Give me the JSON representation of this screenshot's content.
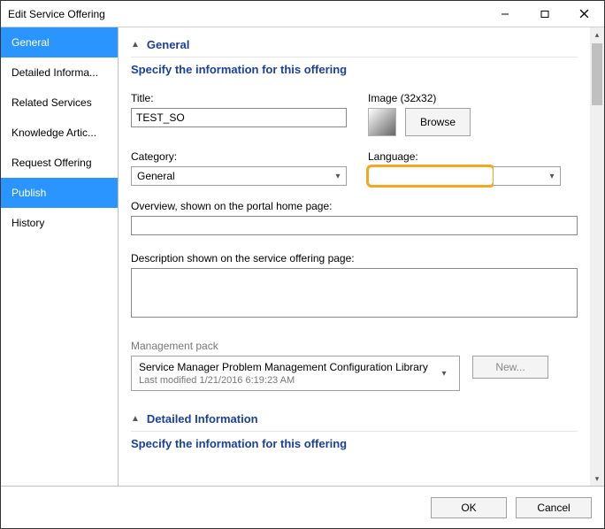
{
  "window": {
    "title": "Edit Service Offering"
  },
  "sidebar": {
    "items": [
      {
        "label": "General"
      },
      {
        "label": "Detailed Informa..."
      },
      {
        "label": "Related Services"
      },
      {
        "label": "Knowledge Artic..."
      },
      {
        "label": "Request Offering"
      },
      {
        "label": "Publish"
      },
      {
        "label": "History"
      }
    ]
  },
  "general": {
    "header": "General",
    "subhead": "Specify the information for this offering",
    "title_label": "Title:",
    "title_value": "TEST_SO",
    "image_label": "Image (32x32)",
    "browse_label": "Browse",
    "category_label": "Category:",
    "category_value": "General",
    "language_label": "Language:",
    "language_value": "",
    "overview_label": "Overview, shown on the portal home page:",
    "overview_value": "",
    "description_label": "Description shown on the service offering page:",
    "description_value": "",
    "mgmt_label": "Management pack",
    "mgmt_value": "Service Manager Problem Management Configuration Library",
    "mgmt_modified": "Last modified  1/21/2016 6:19:23 AM",
    "new_label": "New..."
  },
  "detailed": {
    "header": "Detailed Information",
    "subhead": "Specify the information for this offering"
  },
  "footer": {
    "ok": "OK",
    "cancel": "Cancel"
  }
}
